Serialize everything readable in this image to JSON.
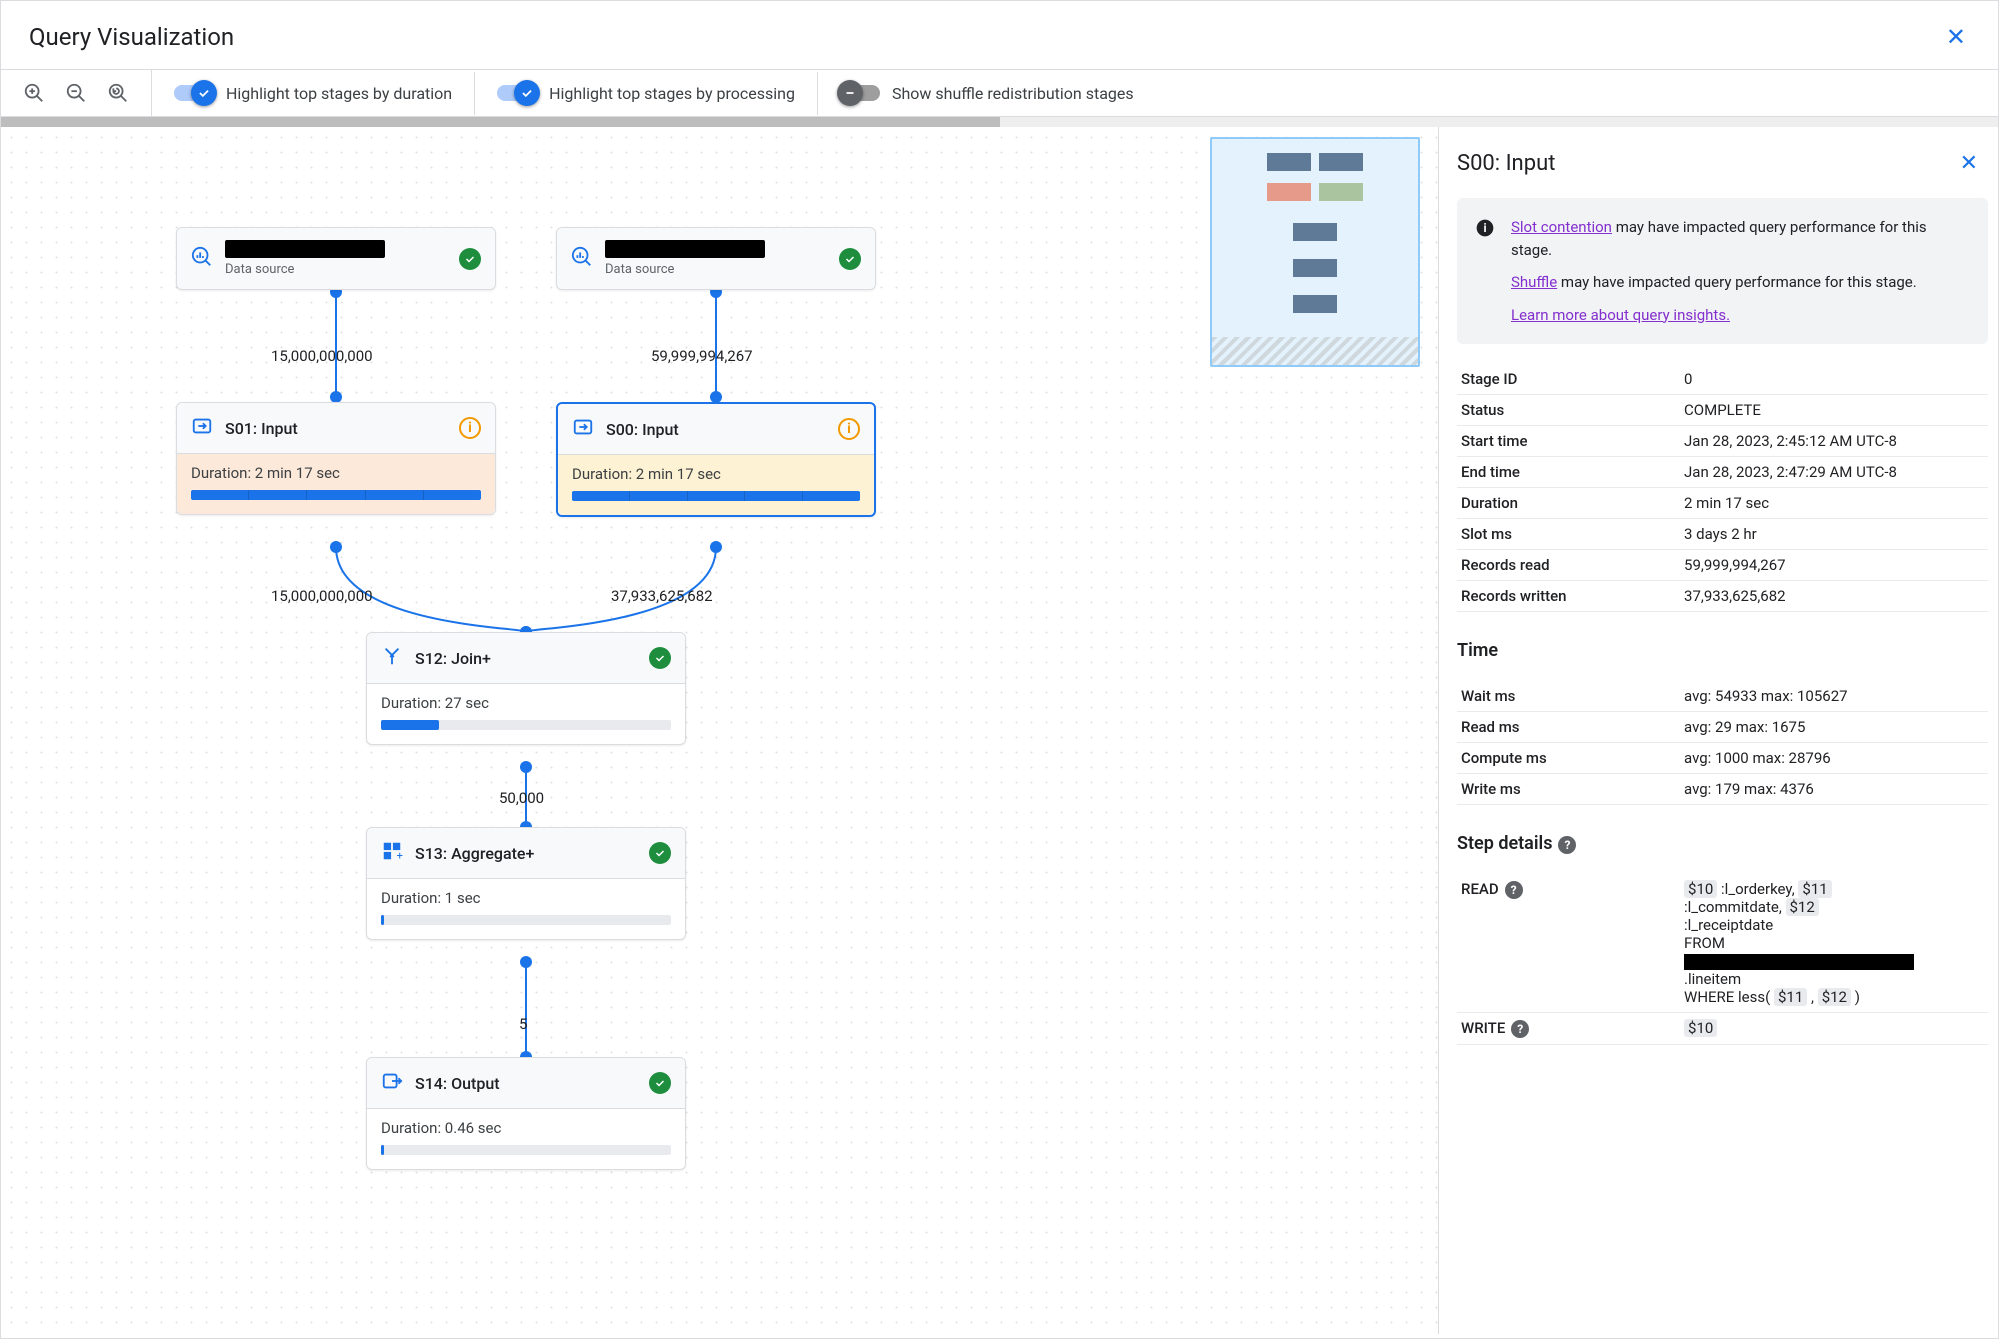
{
  "window": {
    "title": "Query Visualization"
  },
  "toolbar": {
    "highlight_duration": "Highlight top stages by duration",
    "highlight_processing": "Highlight top stages by processing",
    "show_shuffle": "Show shuffle redistribution stages"
  },
  "graph": {
    "ds0": {
      "sub": "Data source"
    },
    "ds1": {
      "sub": "Data source"
    },
    "edge_ds0_s01": "15,000,000,000",
    "edge_ds1_s00": "59,999,994,267",
    "s01": {
      "title": "S01: Input",
      "duration_label": "Duration: 2 min 17 sec",
      "fill_pct": 100
    },
    "s00": {
      "title": "S00: Input",
      "duration_label": "Duration: 2 min 17 sec",
      "fill_pct": 100
    },
    "edge_s01_s12": "15,000,000,000",
    "edge_s00_s12": "37,933,625,682",
    "s12": {
      "title": "S12: Join+",
      "duration_label": "Duration: 27 sec",
      "fill_pct": 20
    },
    "edge_s12_s13": "50,000",
    "s13": {
      "title": "S13: Aggregate+",
      "duration_label": "Duration: 1 sec",
      "fill_pct": 1
    },
    "edge_s13_s14": "5",
    "s14": {
      "title": "S14: Output",
      "duration_label": "Duration: 0.46 sec",
      "fill_pct": 1
    }
  },
  "side": {
    "title": "S00: Input",
    "notice": {
      "slot_link": "Slot contention",
      "slot_tail": " may have impacted query performance for this stage.",
      "shuffle_link": "Shuffle",
      "shuffle_tail": " may have impacted query performance for this stage.",
      "learn_link": "Learn more about query insights."
    },
    "rows": {
      "stage_id_k": "Stage ID",
      "stage_id_v": "0",
      "status_k": "Status",
      "status_v": "COMPLETE",
      "start_k": "Start time",
      "start_v": "Jan 28, 2023, 2:45:12 AM UTC-8",
      "end_k": "End time",
      "end_v": "Jan 28, 2023, 2:47:29 AM UTC-8",
      "duration_k": "Duration",
      "duration_v": "2 min 17 sec",
      "slot_k": "Slot ms",
      "slot_v": "3 days 2 hr",
      "recread_k": "Records read",
      "recread_v": "59,999,994,267",
      "recwrit_k": "Records written",
      "recwrit_v": "37,933,625,682"
    },
    "time_h": "Time",
    "time": {
      "wait_k": "Wait ms",
      "wait_v": "avg: 54933 max: 105627",
      "read_k": "Read ms",
      "read_v": "avg: 29 max: 1675",
      "compute_k": "Compute ms",
      "compute_v": "avg: 1000 max: 28796",
      "write_k": "Write ms",
      "write_v": "avg: 179 max: 4376"
    },
    "steps_h": "Step details",
    "steps": {
      "read_k": "READ",
      "read_v": {
        "p1a": "$10",
        "p1b": " :l_orderkey, ",
        "p1c": "$11",
        "p2a": " :l_commitdate, ",
        "p2b": "$12",
        "p3": " :l_receiptdate",
        "p4": "FROM",
        "p5": ".lineitem",
        "p6a": "WHERE less( ",
        "p6b": "$11",
        "p6c": " , ",
        "p6d": "$12",
        "p6e": " )"
      },
      "write_k": "WRITE",
      "write_v": "$10"
    }
  }
}
